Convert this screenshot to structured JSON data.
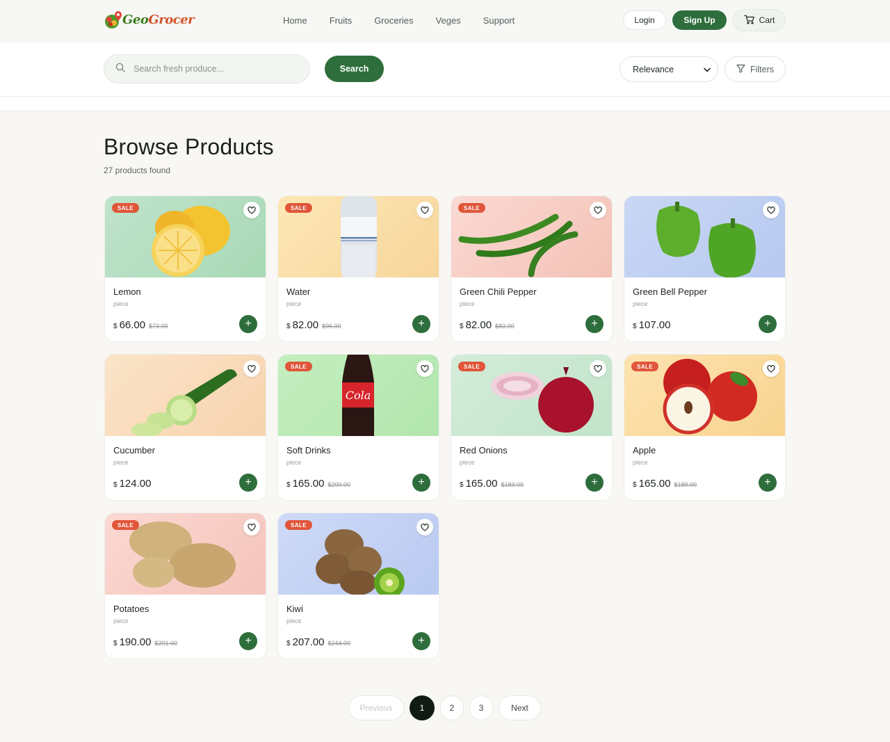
{
  "brand": {
    "name_part1": "Geo",
    "name_part2": "Grocer"
  },
  "nav": [
    {
      "label": "Home"
    },
    {
      "label": "Fruits"
    },
    {
      "label": "Groceries"
    },
    {
      "label": "Veges"
    },
    {
      "label": "Support"
    }
  ],
  "auth": {
    "login": "Login",
    "signup": "Sign Up",
    "cart": "Cart"
  },
  "search": {
    "placeholder": "Search fresh produce...",
    "button": "Search"
  },
  "sort": {
    "selected": "Relevance"
  },
  "filters_label": "Filters",
  "page_title": "Browse Products",
  "result_count": "27 products found",
  "currency_symbol": "$",
  "sale_label": "SALE",
  "products": [
    {
      "name": "Lemon",
      "unit": "piece",
      "price": "66.00",
      "old_price": "73.00",
      "sale": true,
      "image": "lemon",
      "bg": [
        "#bfe3cb",
        "#a8d9b6"
      ]
    },
    {
      "name": "Water",
      "unit": "piece",
      "price": "82.00",
      "old_price": "96.00",
      "sale": true,
      "image": "water-bottle",
      "bg": [
        "#fde7b6",
        "#f7d69b"
      ]
    },
    {
      "name": "Green Chili Pepper",
      "unit": "piece",
      "price": "82.00",
      "old_price": "83.00",
      "sale": true,
      "image": "green-chili",
      "bg": [
        "#fbd9d3",
        "#f3c2b6"
      ]
    },
    {
      "name": "Green Bell Pepper",
      "unit": "piece",
      "price": "107.00",
      "old_price": "",
      "sale": false,
      "image": "bell-pepper",
      "bg": [
        "#c9d7f5",
        "#b7c9f0"
      ]
    },
    {
      "name": "Cucumber",
      "unit": "piece",
      "price": "124.00",
      "old_price": "",
      "sale": false,
      "image": "cucumber",
      "bg": [
        "#fbe4c8",
        "#f7d3ae"
      ]
    },
    {
      "name": "Soft Drinks",
      "unit": "piece",
      "price": "165.00",
      "old_price": "200.00",
      "sale": true,
      "image": "cola-bottle",
      "bg": [
        "#c4eec0",
        "#b2e6ad"
      ]
    },
    {
      "name": "Red Onions",
      "unit": "piece",
      "price": "165.00",
      "old_price": "183.00",
      "sale": true,
      "image": "red-onion",
      "bg": [
        "#d3ecd9",
        "#c2e4ca"
      ]
    },
    {
      "name": "Apple",
      "unit": "piece",
      "price": "165.00",
      "old_price": "189.00",
      "sale": true,
      "image": "apple",
      "bg": [
        "#fde3b0",
        "#f8d48f"
      ]
    },
    {
      "name": "Potatoes",
      "unit": "piece",
      "price": "190.00",
      "old_price": "201.00",
      "sale": true,
      "image": "potato",
      "bg": [
        "#fbd8d2",
        "#f4c4bb"
      ]
    },
    {
      "name": "Kiwi",
      "unit": "piece",
      "price": "207.00",
      "old_price": "244.00",
      "sale": true,
      "image": "kiwi",
      "bg": [
        "#cfdaf7",
        "#b9c9f1"
      ]
    }
  ],
  "pagination": {
    "previous": "Previous",
    "pages": [
      "1",
      "2",
      "3"
    ],
    "current": "1",
    "next": "Next"
  },
  "colors": {
    "primary": "#2e6e3c",
    "sale": "#e0563a",
    "background": "#f8f7f3"
  }
}
